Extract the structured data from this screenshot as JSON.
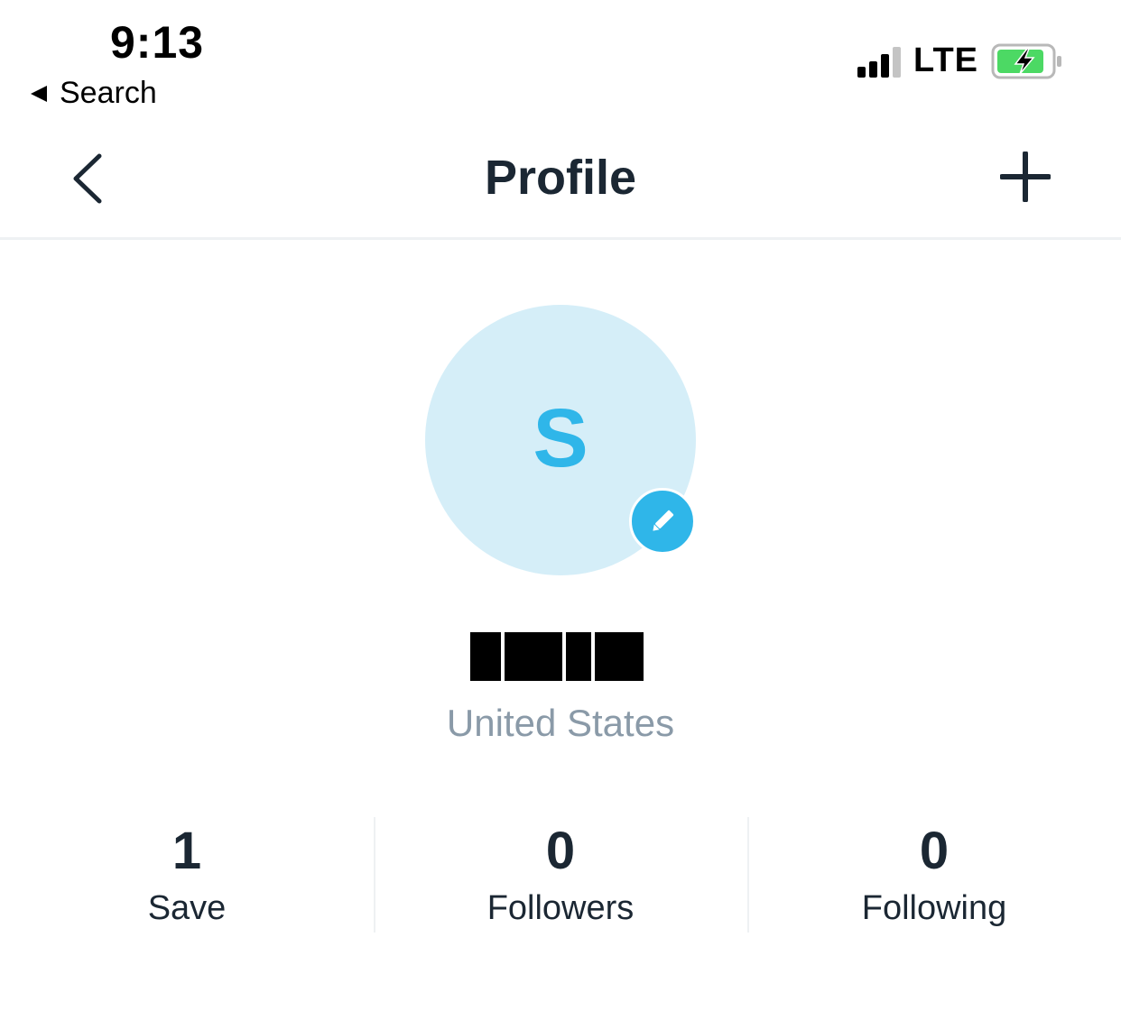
{
  "status_bar": {
    "time": "9:13",
    "back_app_label": "Search",
    "network": "LTE",
    "signal_bars": 3,
    "battery_charging": true
  },
  "navbar": {
    "title": "Profile",
    "back_icon": "chevron-left-icon",
    "add_icon": "plus-icon"
  },
  "profile": {
    "avatar_initial": "S",
    "location": "United States"
  },
  "stats": [
    {
      "value": "1",
      "label": "Save"
    },
    {
      "value": "0",
      "label": "Followers"
    },
    {
      "value": "0",
      "label": "Following"
    }
  ],
  "colors": {
    "accent": "#2fb6e9",
    "avatar_bg": "#d5eef8",
    "text_dark": "#1b2733",
    "text_muted": "#8a9aa8",
    "battery_green": "#4cd964"
  }
}
